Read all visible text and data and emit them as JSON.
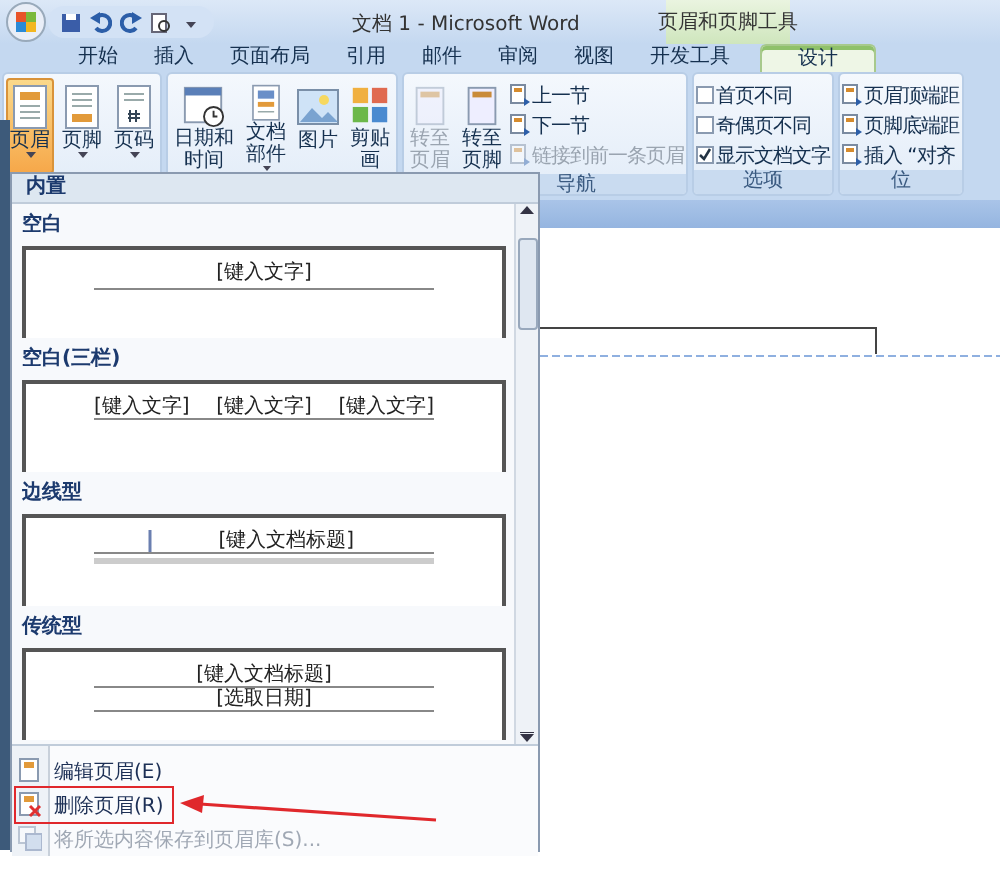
{
  "title_bar": {
    "title": "文档 1 - Microsoft Word",
    "context_label": "页眉和页脚工具"
  },
  "tabs": [
    {
      "label": "开始",
      "selected": false,
      "kind": "normal"
    },
    {
      "label": "插入",
      "selected": false,
      "kind": "normal"
    },
    {
      "label": "页面布局",
      "selected": false,
      "kind": "normal"
    },
    {
      "label": "引用",
      "selected": false,
      "kind": "normal"
    },
    {
      "label": "邮件",
      "selected": false,
      "kind": "normal"
    },
    {
      "label": "审阅",
      "selected": false,
      "kind": "normal"
    },
    {
      "label": "视图",
      "selected": false,
      "kind": "normal"
    },
    {
      "label": "开发工具",
      "selected": false,
      "kind": "normal"
    },
    {
      "label": "设计",
      "selected": true,
      "kind": "contextual"
    }
  ],
  "ribbon": {
    "groups": [
      {
        "items": [
          {
            "kind": "large",
            "label": "页眉",
            "selected": true,
            "dropdown": true
          },
          {
            "kind": "large",
            "label": "页脚",
            "selected": false,
            "dropdown": true
          },
          {
            "kind": "large",
            "label": "页码",
            "selected": false,
            "dropdown": true
          }
        ]
      },
      {
        "items": [
          {
            "kind": "large",
            "label": "日期和时间",
            "selected": false,
            "dropdown": false
          },
          {
            "kind": "large",
            "label": "文档部件",
            "selected": false,
            "dropdown": true
          },
          {
            "kind": "large",
            "label": "图片",
            "selected": false,
            "dropdown": false
          },
          {
            "kind": "large",
            "label": "剪贴画",
            "selected": false,
            "dropdown": false
          }
        ]
      },
      {
        "label": "导航",
        "items": [
          {
            "kind": "large",
            "label": "转至页眉",
            "disabled": true
          },
          {
            "kind": "large",
            "label": "转至页脚",
            "disabled": false
          },
          {
            "kind": "small",
            "label": "上一节",
            "disabled": false
          },
          {
            "kind": "small",
            "label": "下一节",
            "disabled": false
          },
          {
            "kind": "small",
            "label": "链接到前一条页眉",
            "disabled": true
          }
        ]
      },
      {
        "label": "选项",
        "items": [
          {
            "kind": "check",
            "label": "首页不同",
            "checked": false
          },
          {
            "kind": "check",
            "label": "奇偶页不同",
            "checked": false
          },
          {
            "kind": "check",
            "label": "显示文档文字",
            "checked": true
          }
        ]
      },
      {
        "label": "位",
        "items": [
          {
            "kind": "small",
            "label": "页眉顶端距",
            "disabled": false
          },
          {
            "kind": "small",
            "label": "页脚底端距",
            "disabled": false
          },
          {
            "kind": "small",
            "label": "插入 “对齐",
            "disabled": false
          }
        ]
      }
    ]
  },
  "header_menu": {
    "section": "内置",
    "gallery": [
      {
        "name": "空白",
        "kind": "center",
        "texts": [
          "[键入文字]"
        ]
      },
      {
        "name": "空白(三栏)",
        "kind": "three",
        "texts": [
          "[键入文字]",
          "[键入文字]",
          "[键入文字]"
        ]
      },
      {
        "name": "边线型",
        "kind": "sideline",
        "texts": [
          "[键入文档标题]"
        ]
      },
      {
        "name": "传统型",
        "kind": "traditional",
        "texts": [
          "[键入文档标题]",
          "[选取日期]"
        ]
      }
    ],
    "commands": [
      {
        "label": "编辑页眉(E)",
        "disabled": false,
        "annotated": false
      },
      {
        "label": "删除页眉(R)",
        "disabled": false,
        "annotated": true
      },
      {
        "label": "将所选内容保存到页眉库(S)...",
        "disabled": true,
        "annotated": false
      }
    ]
  }
}
